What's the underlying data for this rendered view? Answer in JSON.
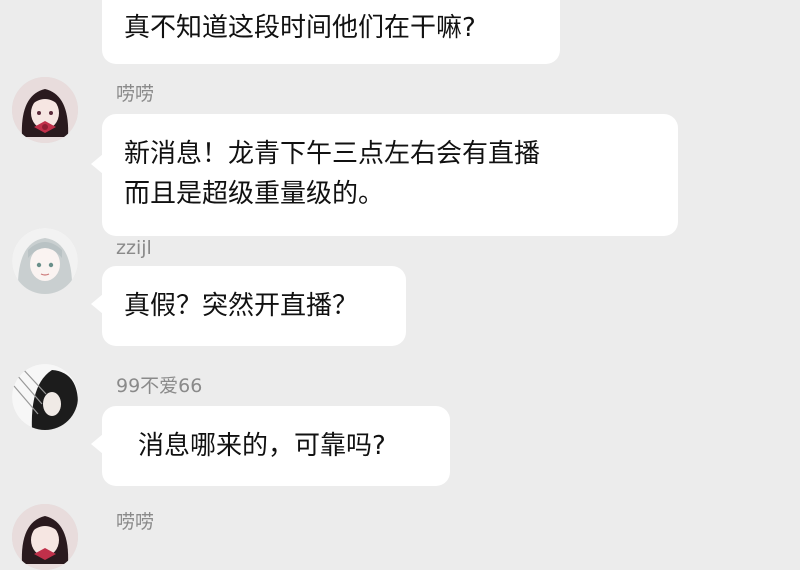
{
  "messages": [
    {
      "sender": "",
      "avatar": "",
      "lines": [
        "真不知道这段时间他们在干嘛?"
      ]
    },
    {
      "sender": "唠唠",
      "avatar": "girl-red-bow-avatar",
      "lines": [
        "新消息！龙青下午三点左右会有直播",
        "而且是超级重量级的。"
      ]
    },
    {
      "sender": "zzijl",
      "avatar": "white-haired-girl-avatar",
      "lines": [
        "真假？突然开直播？"
      ]
    },
    {
      "sender": "99不爱66",
      "avatar": "dark-haired-sketch-avatar",
      "lines": [
        "消息哪来的，可靠吗?"
      ]
    },
    {
      "sender": "唠唠",
      "avatar": "girl-red-bow-avatar",
      "lines": []
    }
  ]
}
